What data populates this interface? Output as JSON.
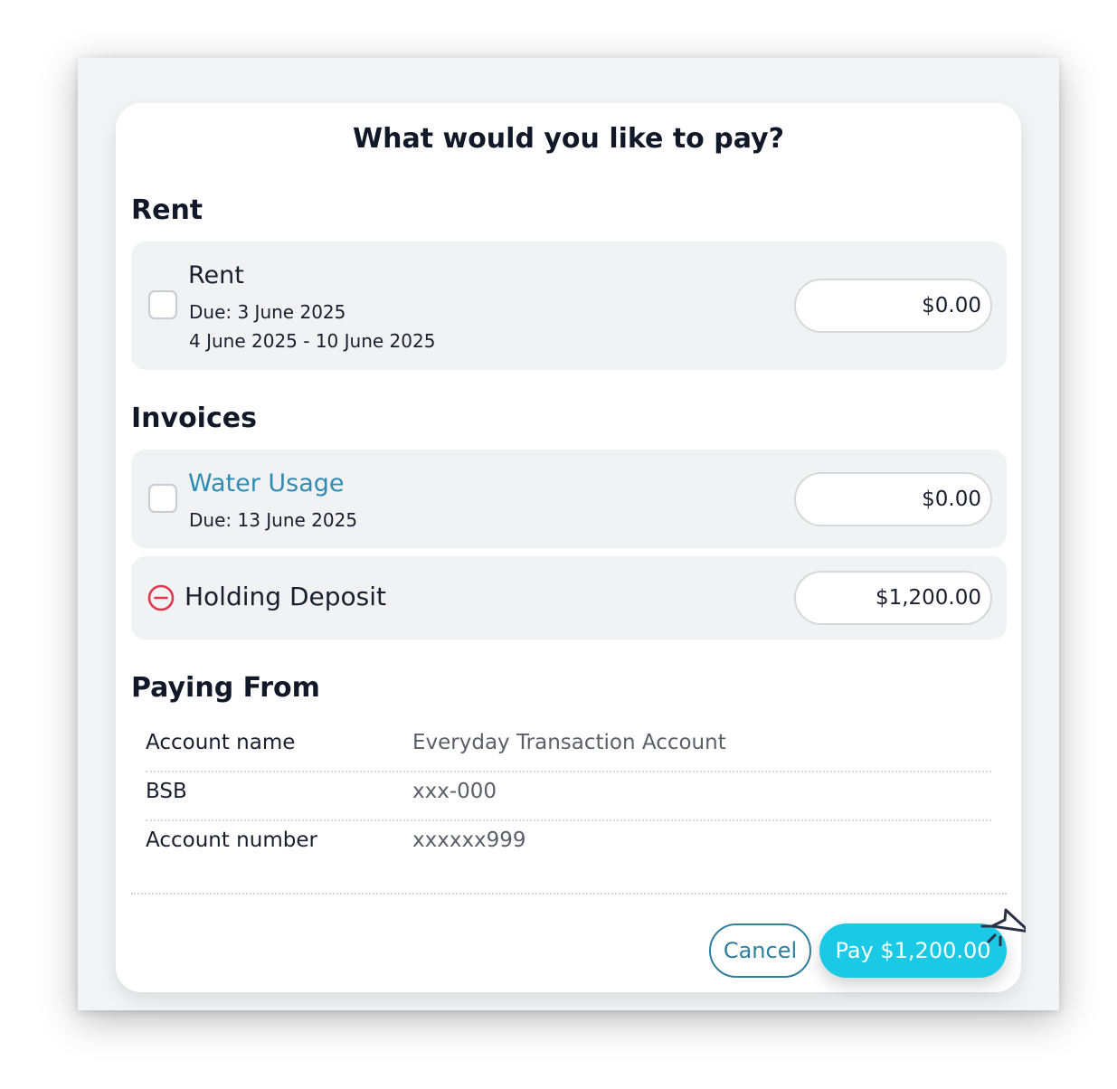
{
  "dialog": {
    "title": "What would you like to pay?"
  },
  "rent_section": {
    "heading": "Rent",
    "item": {
      "name": "Rent",
      "due": "Due: 3 June 2025",
      "period": "4 June 2025 - 10 June 2025",
      "checked": false,
      "amount": "$0.00"
    }
  },
  "invoices_section": {
    "heading": "Invoices",
    "items": [
      {
        "name": "Water Usage",
        "due": "Due: 13 June 2025",
        "checked": false,
        "amount": "$0.00"
      },
      {
        "name": "Holding Deposit",
        "amount": "$1,200.00",
        "icon": "minus-circle-icon"
      }
    ]
  },
  "paying_from": {
    "heading": "Paying From",
    "rows": [
      {
        "label": "Account name",
        "value": "Everyday Transaction Account"
      },
      {
        "label": "BSB",
        "value": "xxx-000"
      },
      {
        "label": "Account number",
        "value": "xxxxxx999"
      }
    ]
  },
  "actions": {
    "cancel_label": "Cancel",
    "pay_label": "Pay $1,200.00"
  },
  "colors": {
    "primary_button": "#19c9e6",
    "link": "#2f8db5",
    "remove_icon": "#e0394d",
    "cancel_border": "#2f7f9f"
  }
}
